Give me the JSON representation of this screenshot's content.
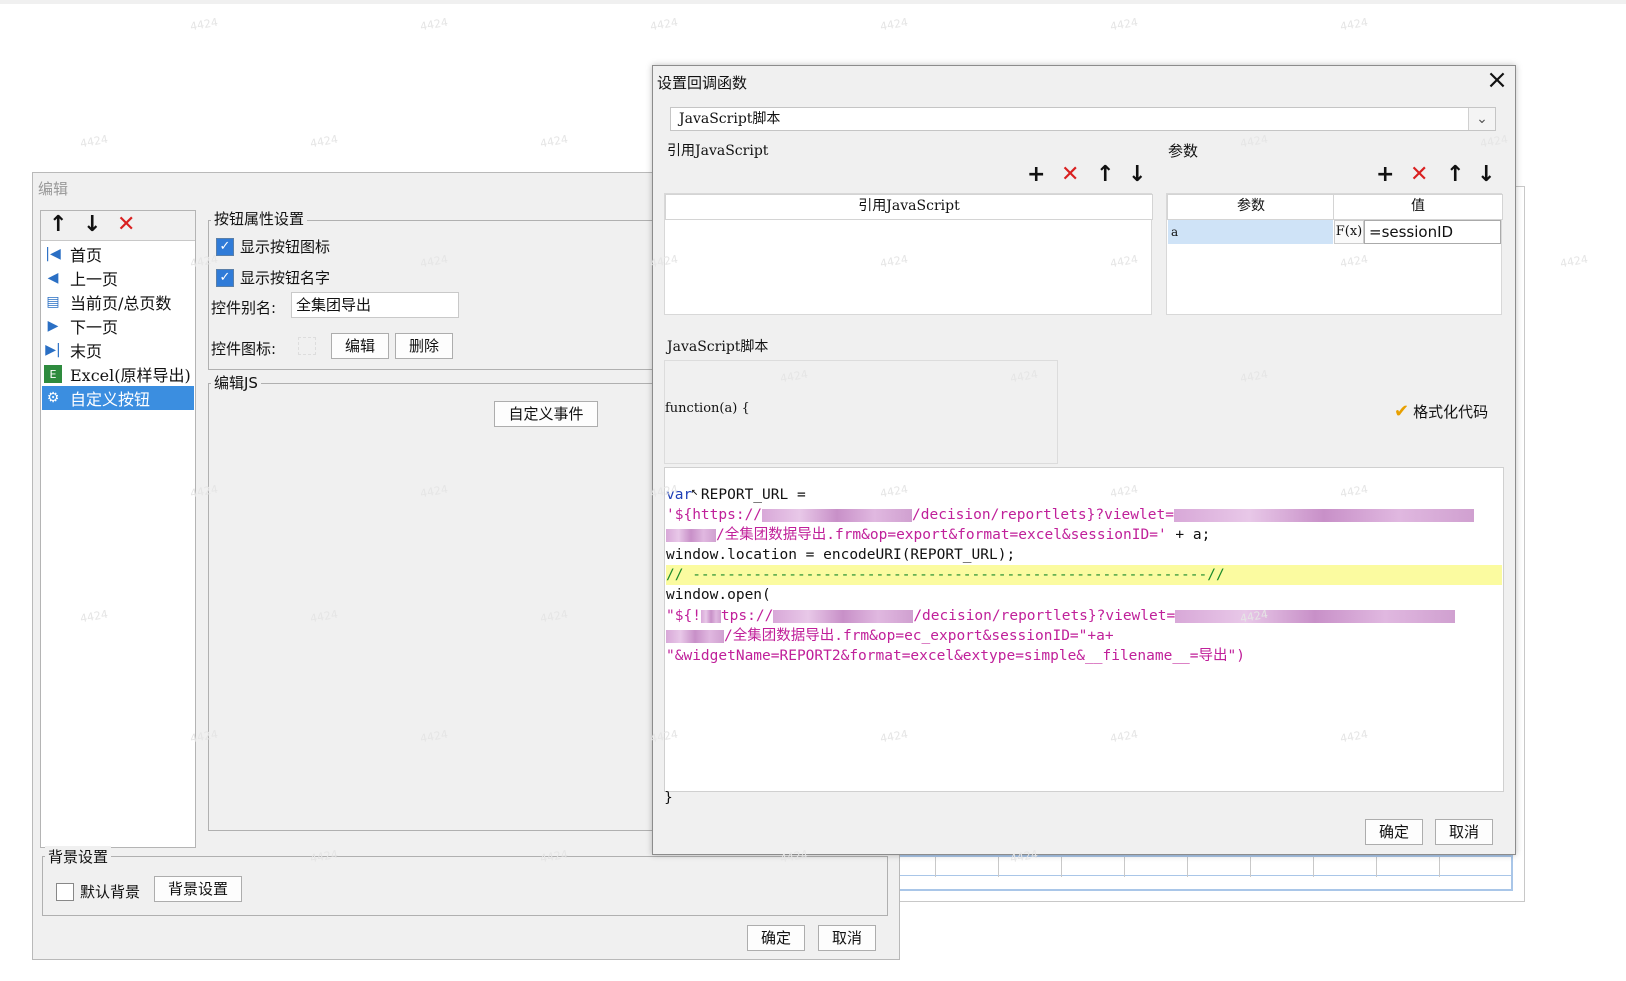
{
  "editor": {
    "title": "编辑",
    "nav_items": [
      {
        "label": "首页",
        "icon": "first-page-icon",
        "glyph": "|◀"
      },
      {
        "label": "上一页",
        "icon": "prev-page-icon",
        "glyph": "◀"
      },
      {
        "label": "当前页/总页数",
        "icon": "page-count-icon",
        "glyph": "▤"
      },
      {
        "label": "下一页",
        "icon": "next-page-icon",
        "glyph": "▶"
      },
      {
        "label": "末页",
        "icon": "last-page-icon",
        "glyph": "▶|"
      },
      {
        "label": "Excel(原样导出)",
        "icon": "excel-icon",
        "glyph": "E"
      },
      {
        "label": "自定义按钮",
        "icon": "gear-icon",
        "glyph": "⚙"
      }
    ],
    "button_props": {
      "legend": "按钮属性设置",
      "show_icon_label": "显示按钮图标",
      "show_icon_checked": true,
      "show_name_label": "显示按钮名字",
      "show_name_checked": true,
      "alias_label": "控件别名:",
      "alias_value": "全集团导出",
      "icon_label": "控件图标:",
      "edit_btn": "编辑",
      "delete_btn": "删除"
    },
    "js_legend": "编辑JS",
    "custom_event_btn": "自定义事件",
    "bg_settings": {
      "legend": "背景设置",
      "default_bg_label": "默认背景",
      "default_bg_checked": false,
      "bg_btn": "背景设置"
    },
    "ok": "确定",
    "cancel": "取消"
  },
  "callback": {
    "title": "设置回调函数",
    "type_value": "JavaScript脚本",
    "ref_js_label": "引用JavaScript",
    "ref_js_col": "引用JavaScript",
    "params_label": "参数",
    "params_cols": [
      "参数",
      "值"
    ],
    "params_rows": [
      {
        "name": "a",
        "value": "=sessionID"
      }
    ],
    "formula_label": "F(x)",
    "script_label": "JavaScript脚本",
    "function_sig": "function(a) {",
    "format_code_label": "格式化代码",
    "closing_brace": "}",
    "code": {
      "l1_kw": "var",
      "l1": " REPORT_URL =",
      "l2a": "'${https://",
      "l2b": "/decision/reportlets}?viewlet=",
      "l3": "/全集团数据导出.frm&op=export&format=excel&sessionID='",
      "l3b": " + a;",
      "l4": "window.location = encodeURI(REPORT_URL);",
      "l5": "// -----------------------------------------------------------//",
      "l6": "window.open(",
      "l7a": "\"${!",
      "l7b": "tps://",
      "l7c": "/decision/reportlets}?viewlet=",
      "l8": "/全集团数据导出.frm&op=ec_export&sessionID=\"+a+",
      "l9": "\"&widgetName=REPORT2&format=excel&extype=simple&__filename__=导出\")"
    },
    "ok": "确定",
    "cancel": "取消"
  },
  "watermark": "4424"
}
